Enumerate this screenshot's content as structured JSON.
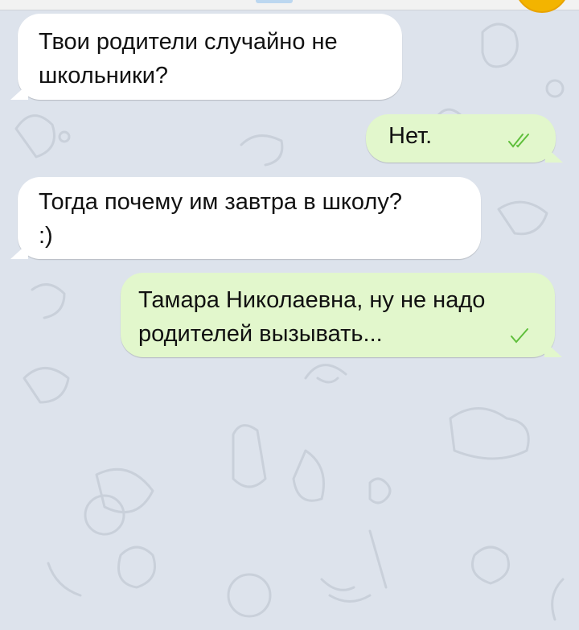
{
  "chat": {
    "messages": [
      {
        "direction": "incoming",
        "text": "Твои родители случайно не\nшкольники?"
      },
      {
        "direction": "outgoing",
        "text": "Нет.",
        "status": "read",
        "status_icon": "double-check-icon"
      },
      {
        "direction": "incoming",
        "text": "Тогда почему им завтра в школу?\n:)"
      },
      {
        "direction": "outgoing",
        "text": "Тамара Николаевна, ну не надо\nродителей вызывать...",
        "status": "delivered",
        "status_icon": "check-icon"
      }
    ]
  },
  "colors": {
    "background": "#dde3ec",
    "incoming_bubble": "#ffffff",
    "outgoing_bubble": "#e2f7cc",
    "check_mark": "#5fbf3b",
    "avatar": "#f3b400"
  }
}
